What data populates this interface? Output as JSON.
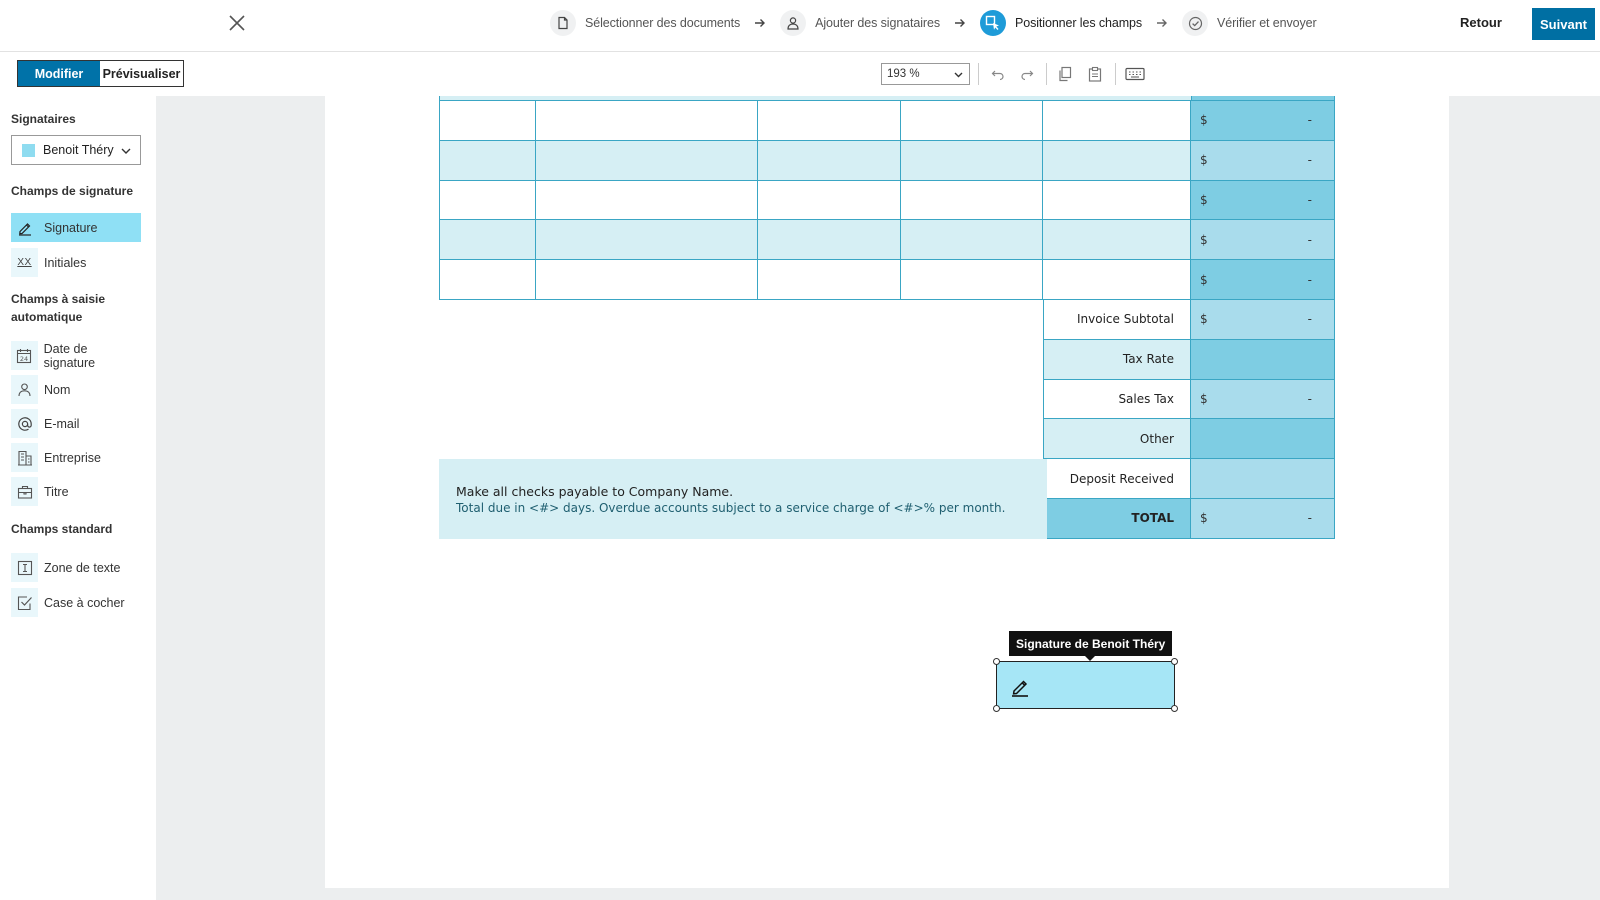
{
  "header": {
    "steps": [
      {
        "label": "Sélectionner des documents",
        "icon": "document-icon",
        "active": false
      },
      {
        "label": "Ajouter des signataires",
        "icon": "person-icon",
        "active": false
      },
      {
        "label": "Positionner les champs",
        "icon": "place-fields-icon",
        "active": true
      },
      {
        "label": "Vérifier et envoyer",
        "icon": "check-circle-icon",
        "active": false
      }
    ],
    "back_label": "Retour",
    "next_label": "Suivant"
  },
  "toolbar": {
    "edit_label": "Modifier",
    "preview_label": "Prévisualiser",
    "zoom": "193 %"
  },
  "sidebar": {
    "signers_heading": "Signataires",
    "signer_name": "Benoit Théry",
    "signature_fields_heading": "Champs de signature",
    "signature_fields": [
      {
        "label": "Signature",
        "icon": "pen-icon",
        "selected": true
      },
      {
        "label": "Initiales",
        "icon": "initials-icon",
        "icon_text": "XX",
        "selected": false
      }
    ],
    "autofill_heading": "Champs à saisie automatique",
    "autofill_fields": [
      {
        "label": "Date de signature",
        "icon": "calendar-icon",
        "icon_text": "24"
      },
      {
        "label": "Nom",
        "icon": "person-icon"
      },
      {
        "label": "E-mail",
        "icon": "at-icon"
      },
      {
        "label": "Entreprise",
        "icon": "building-icon"
      },
      {
        "label": "Titre",
        "icon": "briefcase-icon"
      }
    ],
    "standard_heading": "Champs standard",
    "standard_fields": [
      {
        "label": "Zone de texte",
        "icon": "text-box-icon"
      },
      {
        "label": "Case à cocher",
        "icon": "checkbox-icon"
      }
    ]
  },
  "document": {
    "currency_symbol": "$",
    "dash": "-",
    "summary_rows": [
      {
        "label": "Invoice Subtotal",
        "has_value": true
      },
      {
        "label": "Tax Rate",
        "has_value": false
      },
      {
        "label": "Sales Tax",
        "has_value": true
      },
      {
        "label": "Other",
        "has_value": false
      },
      {
        "label": "Deposit Received",
        "has_value": false
      },
      {
        "label": "TOTAL",
        "has_value": true
      }
    ],
    "note_line1": "Make all checks payable to Company Name.",
    "note_line2": "Total due in <#> days. Overdue accounts subject to a service charge of <#>% per month."
  },
  "signature_field": {
    "tooltip": "Signature de Benoit Théry"
  },
  "colors": {
    "accent": "#1e9bd8",
    "primary_button": "#006fa3",
    "table_border": "#3aa6c4",
    "row_light": "#d6eff4",
    "amount_dark": "#7ecde3",
    "amount_light": "#a9dcec",
    "field_fill": "#a6e6f6"
  }
}
